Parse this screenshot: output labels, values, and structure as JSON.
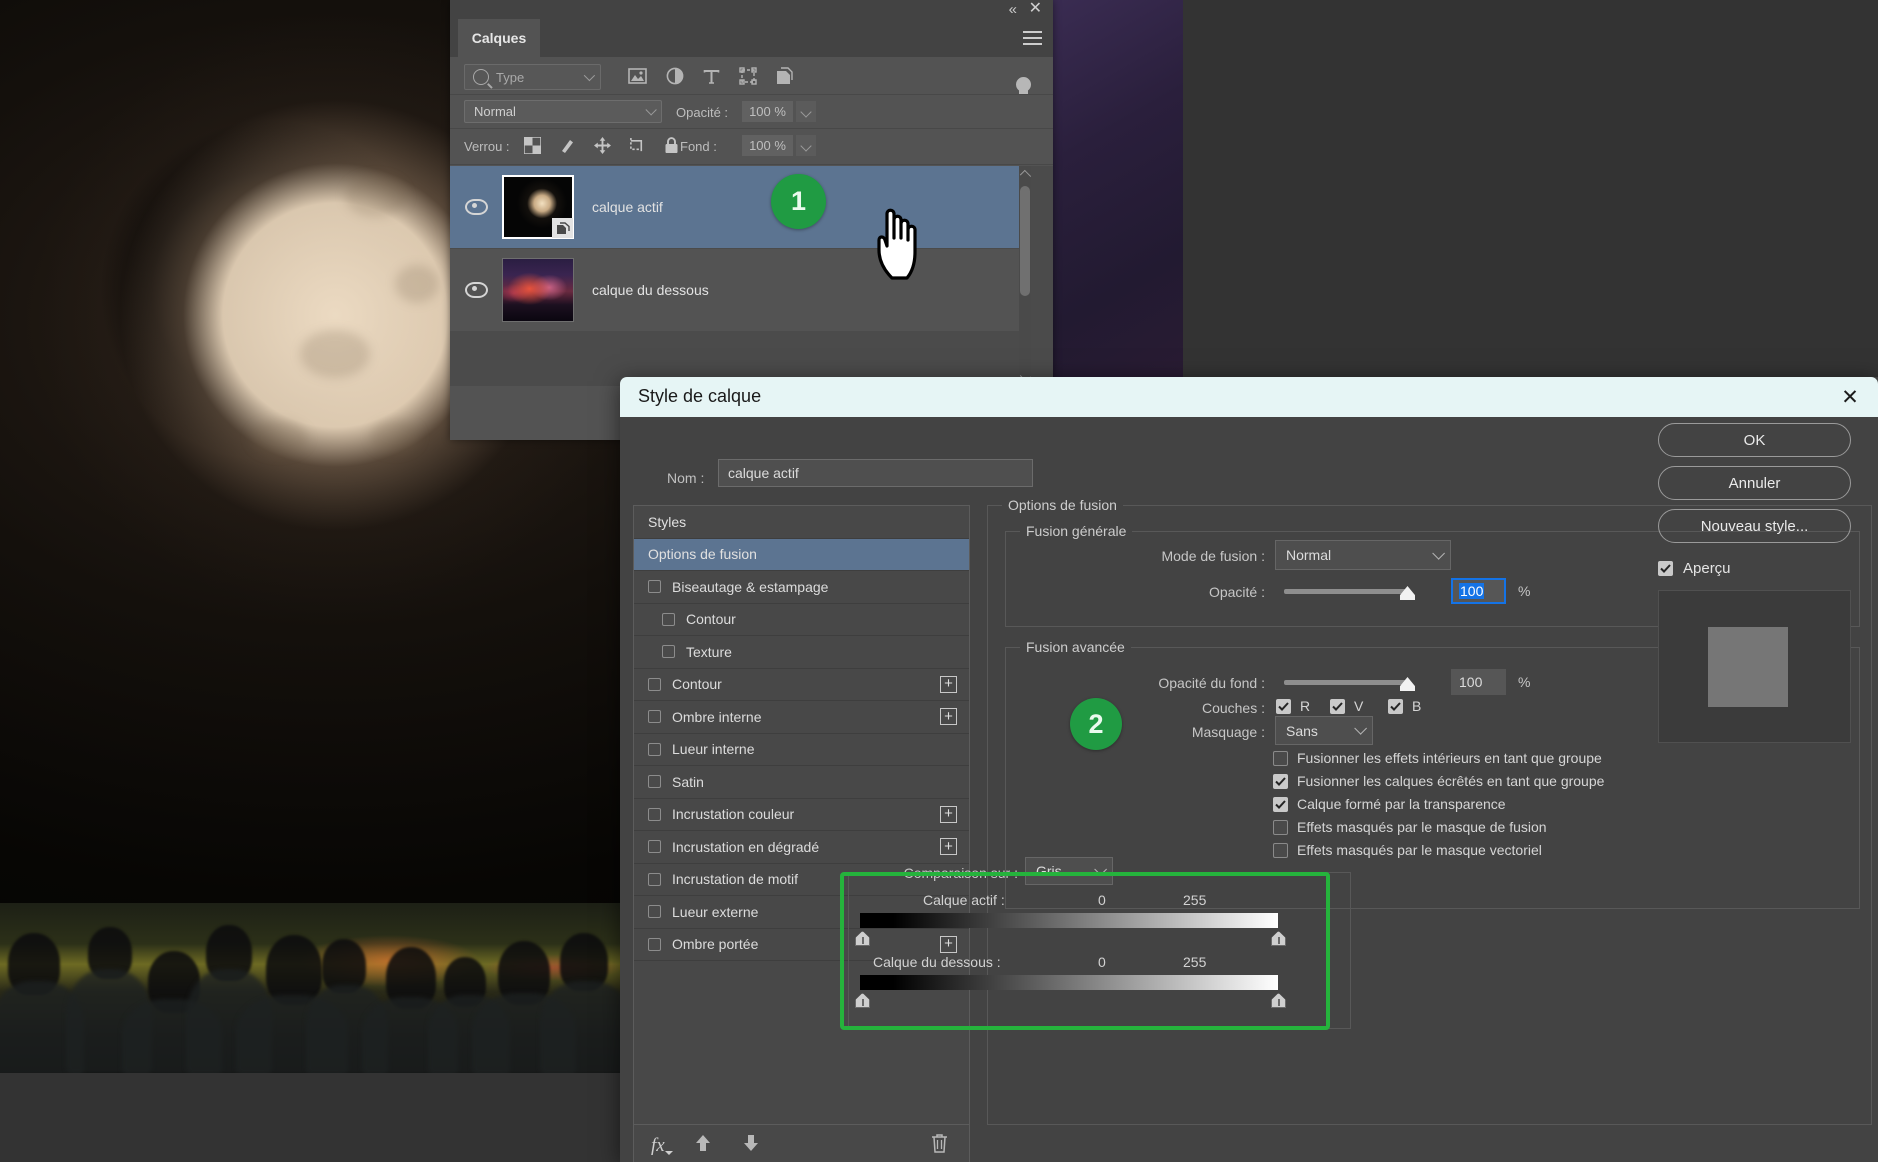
{
  "layers_panel": {
    "tab_label": "Calques",
    "collapse_icon": "collapse-chevrons-icon",
    "close_icon": "close-icon",
    "menu_icon": "panel-menu-icon",
    "filter": {
      "placeholder": "Type",
      "search_icon": "search-icon",
      "filter_icons": [
        "image-filter-icon",
        "adjustment-filter-icon",
        "text-filter-icon",
        "shape-filter-icon",
        "smartobject-filter-icon"
      ],
      "toggle_icon": "filter-toggle-icon"
    },
    "blend_mode": "Normal",
    "opacity_label": "Opacité :",
    "opacity_value": "100 %",
    "lock_label": "Verrou :",
    "lock_icons": [
      "lock-transparent-pixels-icon",
      "lock-image-pixels-icon",
      "lock-position-icon",
      "lock-artboard-icon",
      "lock-all-icon"
    ],
    "fill_label": "Fond :",
    "fill_value": "100 %",
    "layers": [
      {
        "name": "calque actif",
        "selected": true,
        "visible": true,
        "thumb": "moon-thumbnail",
        "has_link_badge": true
      },
      {
        "name": "calque du dessous",
        "selected": false,
        "visible": true,
        "thumb": "balloons-crowd-thumbnail",
        "has_link_badge": false
      }
    ]
  },
  "badges": [
    {
      "number": "1",
      "color": "#209b43"
    },
    {
      "number": "2",
      "color": "#209b43"
    }
  ],
  "dialog": {
    "title": "Style de calque",
    "close_icon": "close-icon",
    "name_label": "Nom :",
    "name_value": "calque actif",
    "styles_list": [
      {
        "label": "Styles",
        "type": "header",
        "checkbox": false,
        "plus": false,
        "indent": false,
        "selected": false
      },
      {
        "label": "Options de fusion",
        "type": "header",
        "checkbox": false,
        "plus": false,
        "indent": false,
        "selected": true
      },
      {
        "label": "Biseautage & estampage",
        "type": "effect",
        "checkbox": true,
        "checked": false,
        "plus": false,
        "indent": false,
        "selected": false
      },
      {
        "label": "Contour",
        "type": "effect",
        "checkbox": true,
        "checked": false,
        "plus": false,
        "indent": true,
        "selected": false
      },
      {
        "label": "Texture",
        "type": "effect",
        "checkbox": true,
        "checked": false,
        "plus": false,
        "indent": true,
        "selected": false
      },
      {
        "label": "Contour",
        "type": "effect",
        "checkbox": true,
        "checked": false,
        "plus": true,
        "indent": false,
        "selected": false
      },
      {
        "label": "Ombre interne",
        "type": "effect",
        "checkbox": true,
        "checked": false,
        "plus": true,
        "indent": false,
        "selected": false
      },
      {
        "label": "Lueur interne",
        "type": "effect",
        "checkbox": true,
        "checked": false,
        "plus": false,
        "indent": false,
        "selected": false
      },
      {
        "label": "Satin",
        "type": "effect",
        "checkbox": true,
        "checked": false,
        "plus": false,
        "indent": false,
        "selected": false
      },
      {
        "label": "Incrustation couleur",
        "type": "effect",
        "checkbox": true,
        "checked": false,
        "plus": true,
        "indent": false,
        "selected": false
      },
      {
        "label": "Incrustation en dégradé",
        "type": "effect",
        "checkbox": true,
        "checked": false,
        "plus": true,
        "indent": false,
        "selected": false
      },
      {
        "label": "Incrustation de motif",
        "type": "effect",
        "checkbox": true,
        "checked": false,
        "plus": false,
        "indent": false,
        "selected": false
      },
      {
        "label": "Lueur externe",
        "type": "effect",
        "checkbox": true,
        "checked": false,
        "plus": false,
        "indent": false,
        "selected": false
      },
      {
        "label": "Ombre portée",
        "type": "effect",
        "checkbox": true,
        "checked": false,
        "plus": true,
        "indent": false,
        "selected": false
      }
    ],
    "styles_toolbar": {
      "fx_icon": "fx-icon",
      "up_icon": "move-up-icon",
      "down_icon": "move-down-icon",
      "delete_icon": "trash-icon"
    },
    "options_group": "Options de fusion",
    "general_blending": {
      "legend": "Fusion générale",
      "mode_label": "Mode de fusion :",
      "mode_value": "Normal",
      "opacity_label": "Opacité :",
      "opacity_value": "100",
      "opacity_percent": "%",
      "opacity_slider_pct": 100
    },
    "advanced_blending": {
      "legend": "Fusion avancée",
      "fill_opacity_label": "Opacité du fond :",
      "fill_opacity_value": "100",
      "fill_opacity_percent": "%",
      "fill_slider_pct": 100,
      "channels_label": "Couches :",
      "channels": [
        {
          "label": "R",
          "checked": true
        },
        {
          "label": "V",
          "checked": true
        },
        {
          "label": "B",
          "checked": true
        }
      ],
      "knockout_label": "Masquage :",
      "knockout_value": "Sans",
      "options": [
        {
          "label": "Fusionner les effets intérieurs en tant que groupe",
          "checked": false
        },
        {
          "label": "Fusionner les calques écrêtés en tant que groupe",
          "checked": true
        },
        {
          "label": "Calque formé par la transparence",
          "checked": true
        },
        {
          "label": "Effets masqués par le masque de fusion",
          "checked": false
        },
        {
          "label": "Effets masqués par le masque vectoriel",
          "checked": false
        }
      ]
    },
    "blend_if": {
      "label": "Comparaison sur :",
      "channel_value": "Gris",
      "highlight_color": "#25b33c",
      "sliders": [
        {
          "label": "Calque actif :",
          "min": "0",
          "max": "255"
        },
        {
          "label": "Calque du dessous :",
          "min": "0",
          "max": "255"
        }
      ]
    },
    "buttons": {
      "ok": "OK",
      "cancel": "Annuler",
      "new_style": "Nouveau style...",
      "preview_label": "Aperçu",
      "preview_checked": true
    }
  }
}
